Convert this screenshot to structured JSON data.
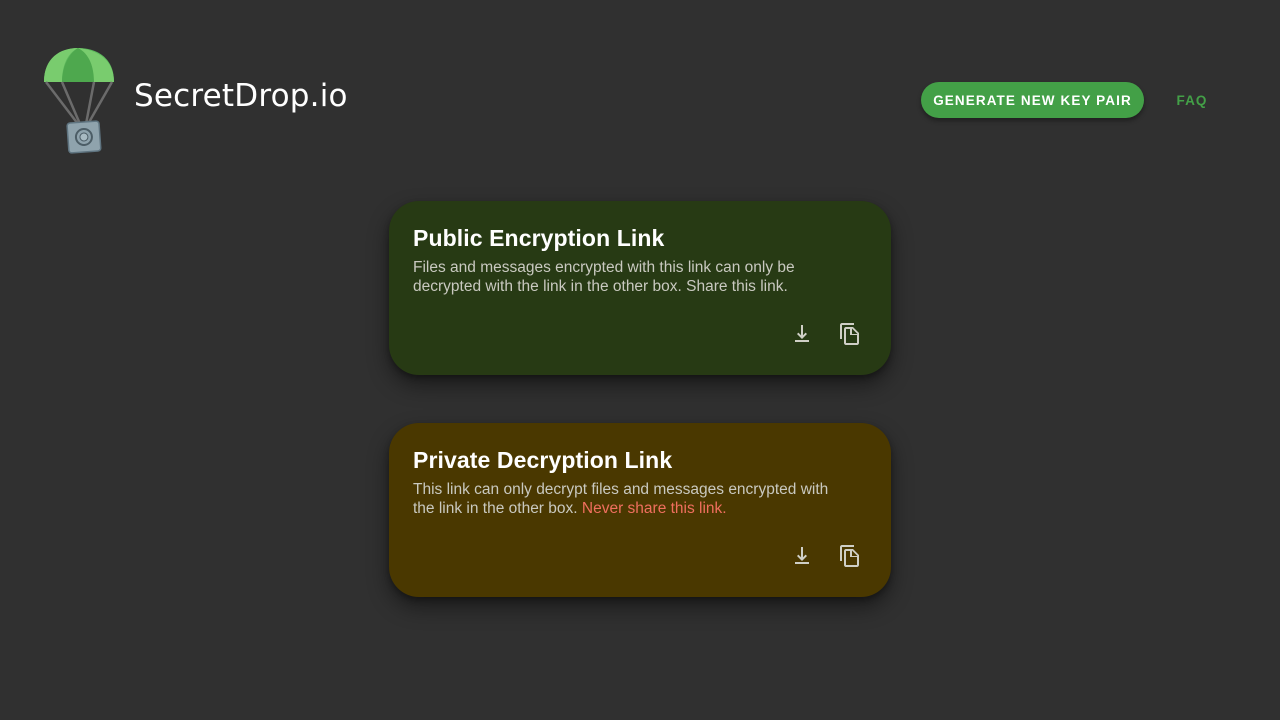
{
  "header": {
    "brand": "SecretDrop.io",
    "generate_button": "GENERATE NEW KEY PAIR",
    "faq_link": "FAQ"
  },
  "colors": {
    "background": "#303030",
    "accent": "#43a047",
    "public_card": "#273a14",
    "private_card": "#4a3800",
    "warning_text": "#ef6f5e"
  },
  "cards": {
    "public": {
      "title": "Public Encryption Link",
      "description": "Files and messages encrypted with this link can only be decrypted with the link in the other box. Share this link.",
      "icons": [
        "download-icon",
        "copy-icon"
      ]
    },
    "private": {
      "title": "Private Decryption Link",
      "description": "This link can only decrypt files and messages encrypted with the link in the other box.",
      "warning": "Never share this link.",
      "icons": [
        "download-icon",
        "copy-icon"
      ]
    }
  }
}
